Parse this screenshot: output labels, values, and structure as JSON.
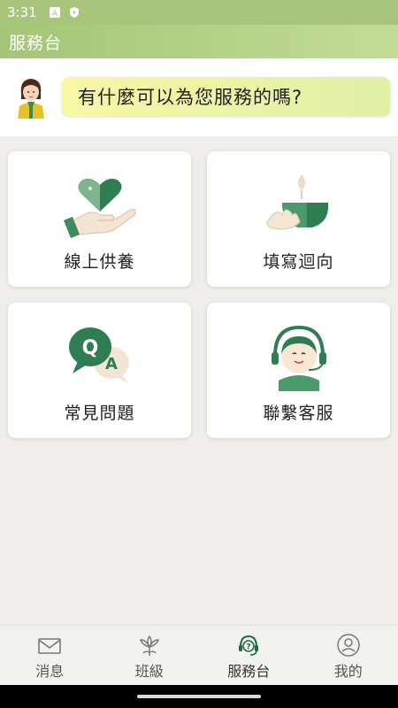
{
  "status": {
    "time": "3:31"
  },
  "app_bar": {
    "title": "服務台"
  },
  "greeting": {
    "text": "有什麼可以為您服務的嗎?"
  },
  "cards": [
    {
      "label": "線上供養",
      "icon": "heart-hand-icon"
    },
    {
      "label": "填寫迴向",
      "icon": "lotus-candle-icon"
    },
    {
      "label": "常見問題",
      "icon": "qa-bubbles-icon"
    },
    {
      "label": "聯繫客服",
      "icon": "headset-agent-icon"
    }
  ],
  "bottom_nav": [
    {
      "label": "消息",
      "icon": "envelope-icon",
      "active": false
    },
    {
      "label": "班級",
      "icon": "lotus-icon",
      "active": false
    },
    {
      "label": "服務台",
      "icon": "headset-question-icon",
      "active": true
    },
    {
      "label": "我的",
      "icon": "profile-icon",
      "active": false
    }
  ],
  "colors": {
    "accent": "#2e7d4f",
    "app_bar": "#a9c47b",
    "bubble": "#f3f6a6"
  }
}
